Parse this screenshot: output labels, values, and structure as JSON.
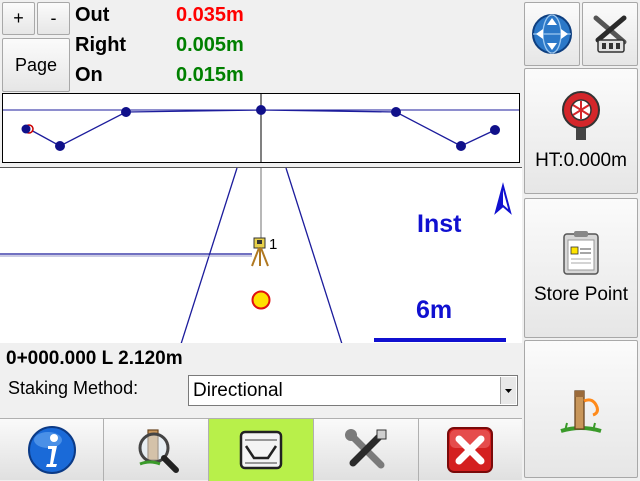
{
  "readout": {
    "plus_label": "+",
    "minus_label": "-",
    "page_label": "Page",
    "rows": [
      {
        "label": "Out",
        "value": "0.035m",
        "color": "#ff0000"
      },
      {
        "label": "Right",
        "value": "0.005m",
        "color": "#008000"
      },
      {
        "label": "On",
        "value": "0.015m",
        "color": "#008000"
      }
    ]
  },
  "map": {
    "mode_label": "Inst",
    "scale_label": "6m",
    "point_label": "1",
    "colors": {
      "line": "#1c1c9c",
      "text": "#1010d0",
      "target": "#ffe000"
    }
  },
  "station": {
    "text": "0+000.000 L 2.120m"
  },
  "staking": {
    "label": "Staking Method:",
    "value": "Directional"
  },
  "side": {
    "ht_label": "HT:0.000m",
    "store_label": "Store Point"
  },
  "toolbar": {
    "active_color": "#b8f04a",
    "items": [
      "info-icon",
      "search-survey-icon",
      "road-profile-icon",
      "tools-icon",
      "close-icon"
    ]
  }
}
